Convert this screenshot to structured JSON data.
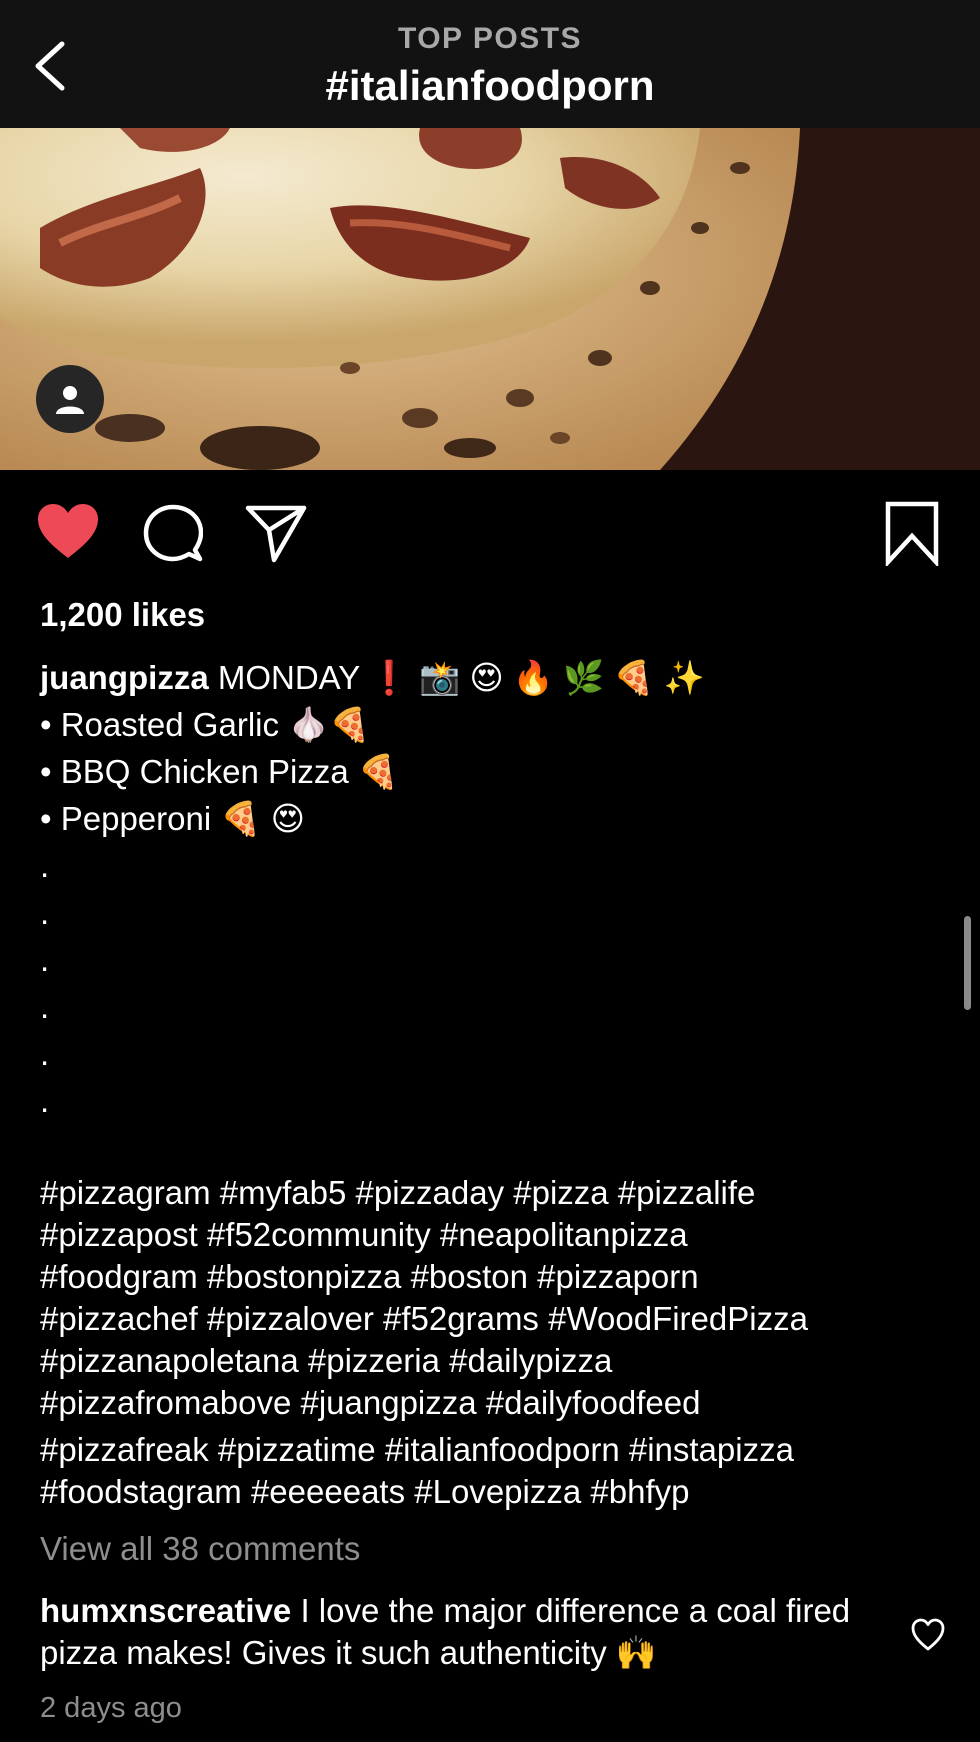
{
  "header": {
    "subtitle": "TOP POSTS",
    "title": "#italianfoodporn"
  },
  "post": {
    "likes": "1,200 likes",
    "username": "juangpizza",
    "caption_first": "MONDAY ❗️ 📸 😍 🔥 🌿 🍕 ✨",
    "bullets": [
      "• Roasted Garlic 🧄🍕",
      "• BBQ Chicken Pizza 🍕",
      "• Pepperoni 🍕 😍"
    ],
    "dots": [
      ".",
      ".",
      ".",
      ".",
      ".",
      "."
    ],
    "hashtag_lines": [
      "#pizzagram #myfab5 #pizzaday #pizza #pizzalife",
      "#pizzapost #f52community  #neapolitanpizza",
      "#foodgram  #bostonpizza #boston #pizzaporn",
      "#pizzachef #pizzalover #f52grams  #WoodFiredPizza",
      "#pizzanapoletana #pizzeria #dailypizza",
      "#pizzafromabove #juangpizza #dailyfoodfeed",
      "#pizzafreak #pizzatime #italianfoodporn #instapizza",
      "#foodstagram #eeeeeats #Lovepizza #bhfyp"
    ],
    "view_comments": "View all 38 comments",
    "comment": {
      "username": "humxnscreative",
      "text": "I love the major difference a coal fired pizza makes! Gives it such authenticity 🙌"
    },
    "timestamp": "2 days ago"
  },
  "icons": {
    "back": "chevron-left-icon",
    "like": "heart-icon",
    "comment": "comment-bubble-icon",
    "share": "paper-plane-icon",
    "save": "bookmark-icon",
    "avatar": "user-icon",
    "comment_like": "heart-outline-icon"
  },
  "colors": {
    "background": "#000000",
    "header_background": "#121212",
    "like_red": "#ed4956",
    "muted_text": "#8e8e8e"
  }
}
